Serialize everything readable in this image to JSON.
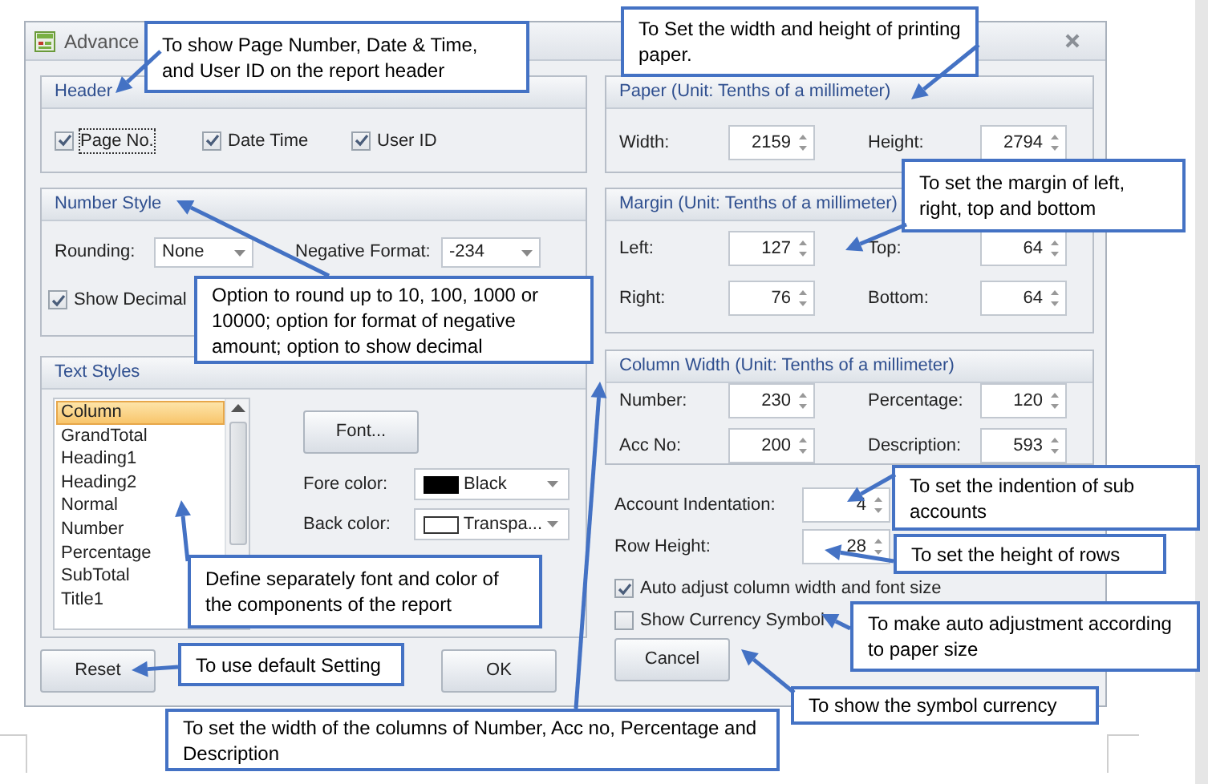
{
  "dialog": {
    "title": "Advance",
    "header": {
      "title": "Header",
      "checkboxes": [
        {
          "label": "Page No.",
          "checked": true,
          "focused": true
        },
        {
          "label": "Date Time",
          "checked": true,
          "focused": false
        },
        {
          "label": "User ID",
          "checked": true,
          "focused": false
        }
      ]
    },
    "number_style": {
      "title": "Number Style",
      "rounding": {
        "label": "Rounding:",
        "value": "None"
      },
      "negative_format": {
        "label": "Negative Format:",
        "value": "-234"
      },
      "show_decimal": {
        "label": "Show Decimal",
        "checked": true
      }
    },
    "text_styles": {
      "title": "Text Styles",
      "items": [
        {
          "label": "Column",
          "selected": true
        },
        {
          "label": "GrandTotal",
          "selected": false
        },
        {
          "label": "Heading1",
          "selected": false
        },
        {
          "label": "Heading2",
          "selected": false
        },
        {
          "label": "Normal",
          "selected": false
        },
        {
          "label": "Number",
          "selected": false
        },
        {
          "label": "Percentage",
          "selected": false
        },
        {
          "label": "SubTotal",
          "selected": false
        },
        {
          "label": "Title1",
          "selected": false
        }
      ],
      "font_button": "Font...",
      "fore_color": {
        "label": "Fore color:",
        "value": "Black",
        "color": "#000000"
      },
      "back_color": {
        "label": "Back color:",
        "value": "Transpa..."
      }
    },
    "paper": {
      "title": "Paper (Unit: Tenths of a millimeter)",
      "fields": [
        {
          "label": "Width:",
          "value": "2159"
        },
        {
          "label": "Height:",
          "value": "2794"
        }
      ]
    },
    "margin": {
      "title": "Margin (Unit: Tenths of a millimeter)",
      "fields": [
        {
          "label": "Left:",
          "value": "127"
        },
        {
          "label": "Top:",
          "value": "64"
        },
        {
          "label": "Right:",
          "value": "76"
        },
        {
          "label": "Bottom:",
          "value": "64"
        }
      ]
    },
    "column_width": {
      "title": "Column Width (Unit: Tenths of a millimeter)",
      "fields": [
        {
          "label": "Number:",
          "value": "230"
        },
        {
          "label": "Percentage:",
          "value": "120"
        },
        {
          "label": "Acc No:",
          "value": "200"
        },
        {
          "label": "Description:",
          "value": "593"
        }
      ]
    },
    "account_indentation": {
      "label": "Account Indentation:",
      "value": "4"
    },
    "row_height": {
      "label": "Row Height:",
      "value": "28"
    },
    "options": [
      {
        "label": "Auto adjust column width and font size",
        "checked": true
      },
      {
        "label": "Show Currency Symbol",
        "checked": false
      }
    ],
    "buttons": {
      "reset": "Reset",
      "ok": "OK",
      "cancel": "Cancel"
    }
  },
  "callouts": [
    {
      "text": "To show Page Number, Date & Time, and User ID on the report header"
    },
    {
      "text": "To Set the width and height of printing paper."
    },
    {
      "text": "To set the margin of left, right, top and bottom"
    },
    {
      "text": "Option to round up to 10, 100, 1000 or 10000; option for format  of negative amount; option to show decimal"
    },
    {
      "text": "Define separately font and color of the components of the report"
    },
    {
      "text": "To use default Setting"
    },
    {
      "text": "To set the width of the columns of Number, Acc no, Percentage and Description"
    },
    {
      "text": "To set the indention of sub accounts"
    },
    {
      "text": "To set the height of rows"
    },
    {
      "text": "To make auto adjustment according to paper size"
    },
    {
      "text": "To show the symbol currency"
    }
  ]
}
